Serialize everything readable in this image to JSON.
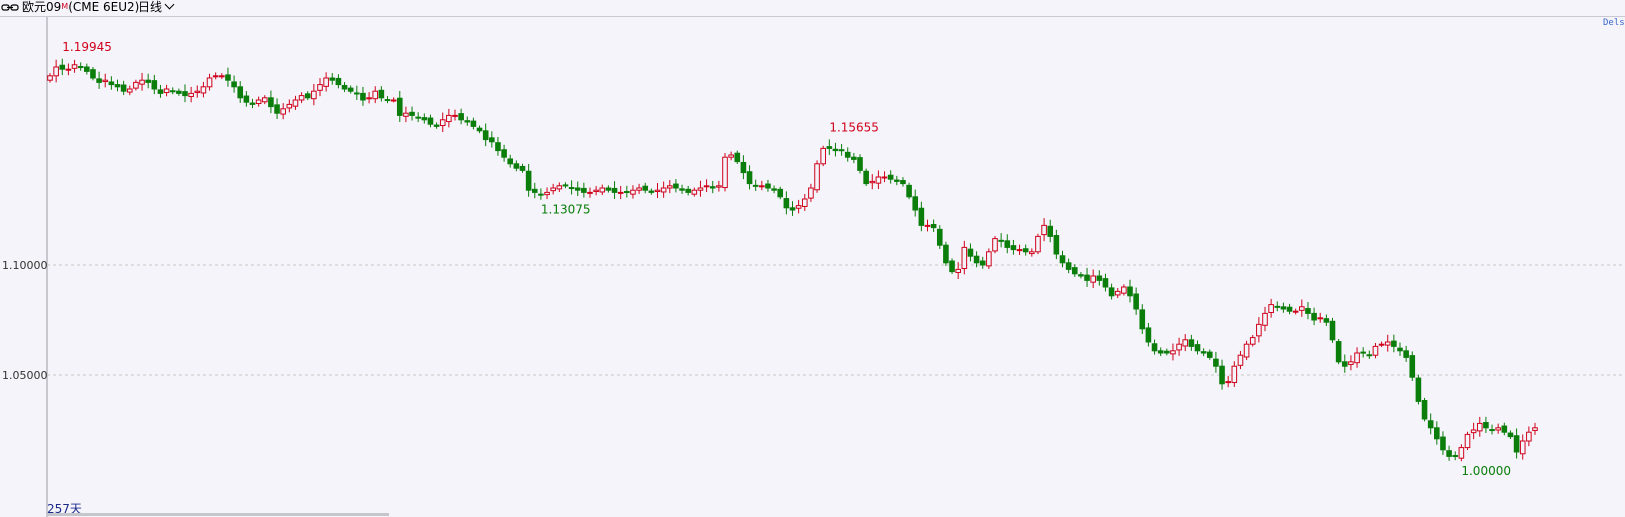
{
  "header": {
    "title": "欧元09",
    "title_sup": "M",
    "symbol": "(CME 6EU2)",
    "period": "日线"
  },
  "footer": {
    "days_label": "257天"
  },
  "corner_label": "Dels",
  "colors": {
    "up": "#d0021b",
    "down": "#0a7d0a",
    "grid": "#c8c8c8",
    "background": "#f4f4fa"
  },
  "chart_data": {
    "type": "candlestick",
    "ylim": [
      1.0,
      1.2
    ],
    "yticks": [
      "1.10000",
      "1.05000"
    ],
    "ytick_values": [
      1.1,
      1.05
    ],
    "gridlines": true,
    "annotations": [
      {
        "text": "1.19945",
        "kind": "high"
      },
      {
        "text": "1.15655",
        "kind": "high"
      },
      {
        "text": "1.13075",
        "kind": "low"
      },
      {
        "text": "1.00000",
        "kind": "low"
      }
    ],
    "close_series": [
      1.186,
      1.19,
      1.189,
      1.189,
      1.191,
      1.19,
      1.188,
      1.185,
      1.183,
      1.184,
      1.182,
      1.181,
      1.179,
      1.18,
      1.183,
      1.184,
      1.183,
      1.18,
      1.178,
      1.18,
      1.179,
      1.178,
      1.177,
      1.178,
      1.179,
      1.181,
      1.185,
      1.186,
      1.186,
      1.184,
      1.181,
      1.176,
      1.174,
      1.173,
      1.175,
      1.176,
      1.172,
      1.169,
      1.171,
      1.173,
      1.175,
      1.177,
      1.176,
      1.179,
      1.182,
      1.185,
      1.184,
      1.182,
      1.18,
      1.179,
      1.178,
      1.175,
      1.176,
      1.179,
      1.176,
      1.175,
      1.175,
      1.168,
      1.169,
      1.168,
      1.167,
      1.166,
      1.164,
      1.163,
      1.166,
      1.168,
      1.168,
      1.166,
      1.165,
      1.163,
      1.161,
      1.157,
      1.156,
      1.152,
      1.149,
      1.146,
      1.144,
      1.143,
      1.134,
      1.133,
      1.132,
      1.133,
      1.135,
      1.136,
      1.136,
      1.135,
      1.134,
      1.133,
      1.133,
      1.134,
      1.135,
      1.134,
      1.133,
      1.133,
      1.133,
      1.134,
      1.135,
      1.134,
      1.133,
      1.134,
      1.135,
      1.136,
      1.135,
      1.134,
      1.133,
      1.134,
      1.135,
      1.136,
      1.135,
      1.136,
      1.149,
      1.15,
      1.147,
      1.142,
      1.137,
      1.136,
      1.136,
      1.135,
      1.134,
      1.131,
      1.126,
      1.125,
      1.127,
      1.13,
      1.135,
      1.146,
      1.153,
      1.153,
      1.152,
      1.152,
      1.149,
      1.148,
      1.143,
      1.137,
      1.138,
      1.14,
      1.14,
      1.139,
      1.138,
      1.137,
      1.131,
      1.125,
      1.118,
      1.118,
      1.117,
      1.109,
      1.101,
      1.097,
      1.098,
      1.108,
      1.104,
      1.101,
      1.1,
      1.106,
      1.112,
      1.111,
      1.108,
      1.107,
      1.107,
      1.106,
      1.106,
      1.113,
      1.118,
      1.113,
      1.105,
      1.101,
      1.098,
      1.096,
      1.095,
      1.093,
      1.095,
      1.093,
      1.09,
      1.086,
      1.088,
      1.09,
      1.086,
      1.08,
      1.071,
      1.065,
      1.061,
      1.06,
      1.06,
      1.061,
      1.064,
      1.066,
      1.063,
      1.061,
      1.06,
      1.058,
      1.054,
      1.046,
      1.047,
      1.054,
      1.059,
      1.064,
      1.067,
      1.073,
      1.078,
      1.082,
      1.081,
      1.08,
      1.079,
      1.079,
      1.081,
      1.078,
      1.075,
      1.076,
      1.074,
      1.066,
      1.056,
      1.054,
      1.056,
      1.06,
      1.06,
      1.059,
      1.063,
      1.064,
      1.065,
      1.063,
      1.061,
      1.058,
      1.049,
      1.038,
      1.03,
      1.026,
      1.021,
      1.016,
      1.013,
      1.013,
      1.017,
      1.023,
      1.025,
      1.028,
      1.026,
      1.025,
      1.026,
      1.024,
      1.022,
      1.015,
      1.02,
      1.024,
      1.026
    ]
  }
}
